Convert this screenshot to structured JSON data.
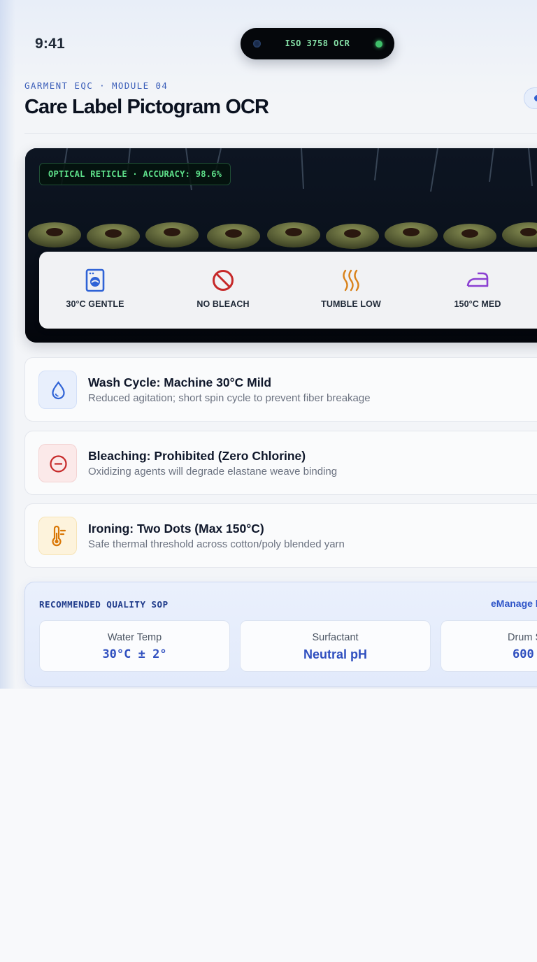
{
  "status_bar": {
    "time": "9:41",
    "island_label": "ISO 3758 OCR"
  },
  "header": {
    "eyebrow": "GARMENT EQC · MODULE 04",
    "title": "Care Label Pictogram OCR"
  },
  "scanner": {
    "reticle_label": "OPTICAL RETICLE · ACCURACY: 98.6%",
    "symbols": [
      {
        "icon": "washing-machine-icon",
        "label": "30°C GENTLE",
        "color": "#2f63d6"
      },
      {
        "icon": "no-bleach-icon",
        "label": "NO BLEACH",
        "color": "#c62828"
      },
      {
        "icon": "tumble-heat-icon",
        "label": "TUMBLE LOW",
        "color": "#d9821a"
      },
      {
        "icon": "iron-icon",
        "label": "150°C MED",
        "color": "#8b3fd1"
      }
    ]
  },
  "instructions": [
    {
      "icon": "water-drop-icon",
      "title": "Wash Cycle: Machine 30°C Mild",
      "subtitle": "Reduced agitation; short spin cycle to prevent fiber breakage",
      "color": "#2f63d6"
    },
    {
      "icon": "minus-circle-icon",
      "title": "Bleaching: Prohibited (Zero Chlorine)",
      "subtitle": "Oxidizing agents will degrade elastane weave binding",
      "color": "#c62828"
    },
    {
      "icon": "thermometer-icon",
      "title": "Ironing: Two Dots (Max 150°C)",
      "subtitle": "Safe thermal threshold across cotton/poly blended yarn",
      "color": "#d97706"
    }
  ],
  "sop": {
    "title": "RECOMMENDED QUALITY SOP",
    "link": "eManage l",
    "metrics": [
      {
        "label": "Water Temp",
        "value": "30°C ± 2°"
      },
      {
        "label": "Surfactant",
        "value": "Neutral pH"
      },
      {
        "label": "Drum S",
        "value": "600"
      }
    ]
  }
}
